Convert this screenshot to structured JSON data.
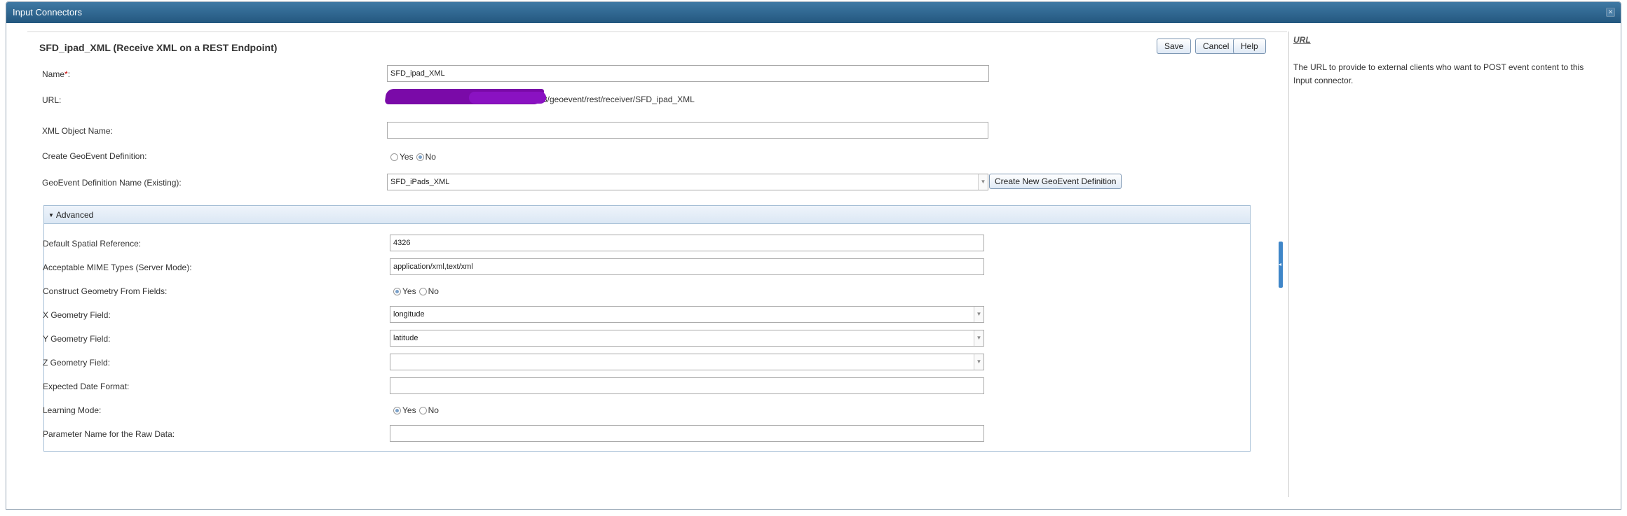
{
  "window": {
    "title": "Input Connectors"
  },
  "form": {
    "title": "SFD_ipad_XML (Receive XML on a REST Endpoint)",
    "buttons": {
      "save": "Save",
      "cancel": "Cancel",
      "help": "Help"
    },
    "name": {
      "label": "Name",
      "required_mark": "*",
      "colon": ":",
      "value": "SFD_ipad_XML"
    },
    "url": {
      "label": "URL:",
      "value": "3/geoevent/rest/receiver/SFD_ipad_XML"
    },
    "xml_object_name": {
      "label": "XML Object Name:",
      "value": ""
    },
    "create_definition": {
      "label": "Create GeoEvent Definition:",
      "yes": "Yes",
      "no": "No",
      "selected": "No"
    },
    "definition_name": {
      "label": "GeoEvent Definition Name (Existing):",
      "value": "SFD_iPads_XML",
      "create_button": "Create New GeoEvent Definition"
    }
  },
  "advanced": {
    "header": "Advanced",
    "default_spatial_reference": {
      "label": "Default Spatial Reference:",
      "value": "4326"
    },
    "mime_types": {
      "label": "Acceptable MIME Types (Server Mode):",
      "value": "application/xml,text/xml"
    },
    "construct_geometry": {
      "label": "Construct Geometry From Fields:",
      "yes": "Yes",
      "no": "No",
      "selected": "Yes"
    },
    "x_field": {
      "label": "X Geometry Field:",
      "value": "longitude"
    },
    "y_field": {
      "label": "Y Geometry Field:",
      "value": "latitude"
    },
    "z_field": {
      "label": "Z Geometry Field:",
      "value": ""
    },
    "date_format": {
      "label": "Expected Date Format:",
      "value": ""
    },
    "learning_mode": {
      "label": "Learning Mode:",
      "yes": "Yes",
      "no": "No",
      "selected": "Yes"
    },
    "raw_data_param": {
      "label": "Parameter Name for the Raw Data:",
      "value": ""
    }
  },
  "help": {
    "title": "URL",
    "text": "The URL to provide to external clients who want to POST event content to this Input connector."
  },
  "icons": {
    "close": "close-icon",
    "expand": "triangle-down-icon",
    "dropdown": "chevron-down-icon",
    "splitter": "collapse-handle-icon"
  },
  "colors": {
    "titlebar": "#23577f",
    "accent": "#3f86c8",
    "redaction": "#7a0aa8"
  }
}
